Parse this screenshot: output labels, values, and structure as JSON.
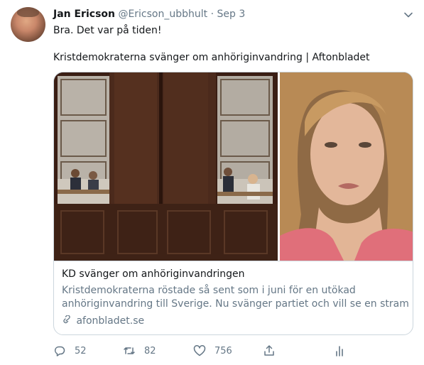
{
  "tweet": {
    "author_name": "Jan Ericson",
    "handle": "@Ericson_ubbhult",
    "separator": "·",
    "date": "Sep 3",
    "text_line1": "Bra. Det var på tiden!",
    "text_line2": "Kristdemokraterna svänger om anhöriginvandring | Aftonbladet"
  },
  "card": {
    "title": "KD svänger om anhöriginvandringen",
    "description_line1": "Kristdemokraterna röstade så sent som i juni för en utökad",
    "description_line2": "anhöriginvandring till Sverige. Nu svänger partiet och vill se en stramare...",
    "domain": "afonbladet.se"
  },
  "actions": {
    "replies": "52",
    "retweets": "82",
    "likes": "756"
  },
  "icons": [
    "chevron-down-icon",
    "reply-icon",
    "retweet-icon",
    "like-icon",
    "share-icon",
    "analytics-icon",
    "link-icon"
  ],
  "colors": {
    "text": "#14171a",
    "secondary": "#657786",
    "border": "#ccd6dd"
  }
}
